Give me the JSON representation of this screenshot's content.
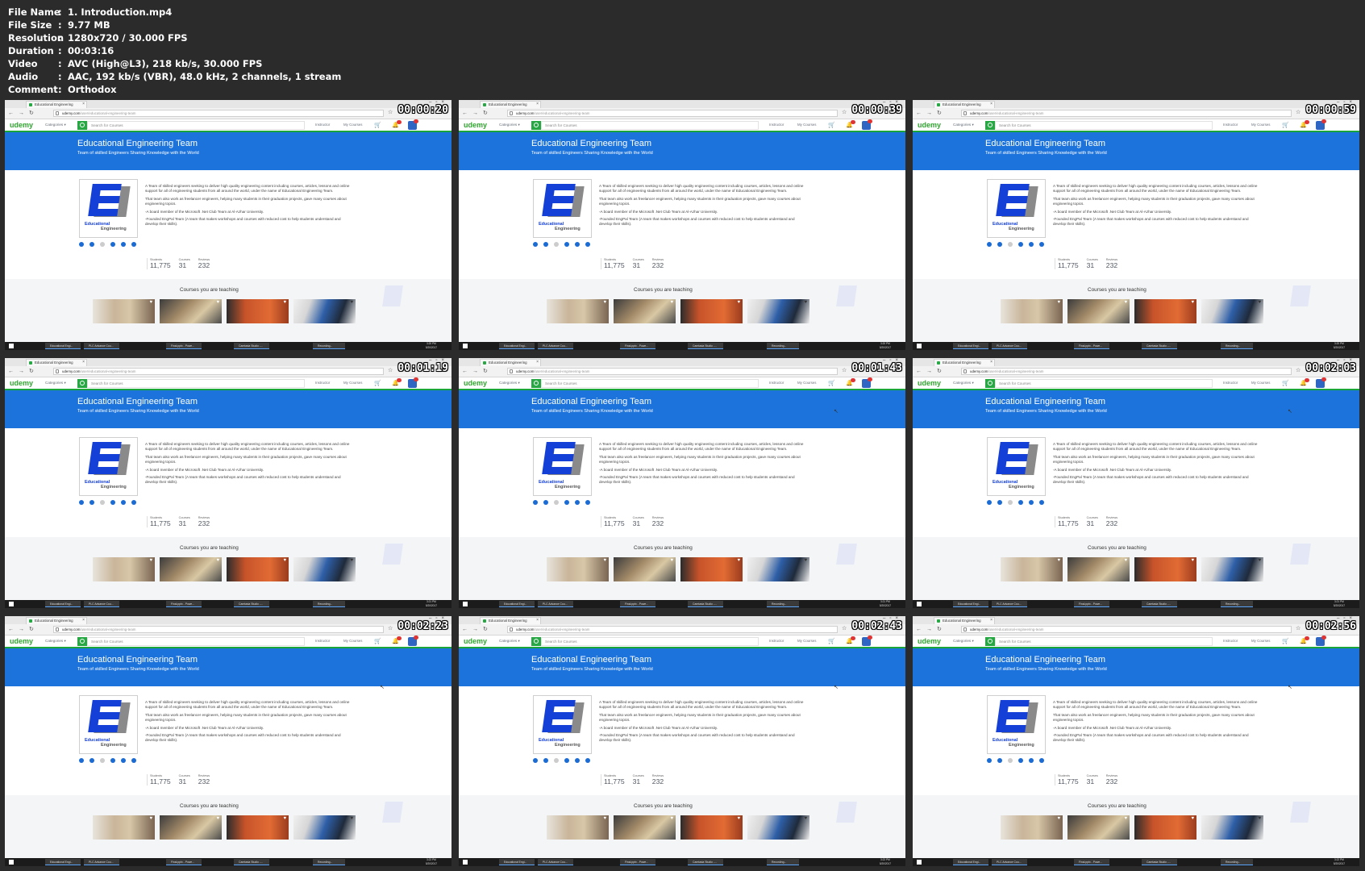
{
  "video_info": [
    {
      "key": "File Name",
      "value": "1. Introduction.mp4"
    },
    {
      "key": "File Size",
      "value": "9.77 MB"
    },
    {
      "key": "Resolution",
      "value": "1280x720 / 30.000 FPS"
    },
    {
      "key": "Duration",
      "value": "00:03:16"
    },
    {
      "key": "Video",
      "value": "AVC (High@L3), 218 kb/s, 30.000 FPS"
    },
    {
      "key": "Audio",
      "value": "AAC, 192 kb/s (VBR), 48.0 kHz, 2 channels, 1 stream"
    },
    {
      "key": "Comment",
      "value": "Orthodox"
    }
  ],
  "meta_separator": ":",
  "timestamps": [
    "00:00:20",
    "00:00:39",
    "00:00:59",
    "00:01:19",
    "00:01:43",
    "00:02:03",
    "00:02:23",
    "00:02:43",
    "00:02:56"
  ],
  "browser": {
    "tab_title": "Educational Engineering",
    "url_host": "udemy.com",
    "url_path": "/user/educational-engineering-team"
  },
  "nav": {
    "logo": "udemy",
    "categories": "Categories ▾",
    "search_placeholder": "Search for Courses",
    "instructor": "Instructor",
    "my_courses": "My Courses"
  },
  "profile": {
    "title": "Educational Engineering Team",
    "subtitle": "Team of skilled Engineers Sharing Knowledge with the World",
    "logo_line1": "Educational",
    "logo_line2": "Engineering",
    "bio": [
      "A Team of skilled engineers seeking to deliver high quality engineering content including courses, articles, lessons and online support for all of engineering students from all around the world, under the name of Educational Engineering Team.",
      "That team also work as freelancer engineers, helping many students in their graduation projects, gave many courses about engineering topics.",
      "-A board member of the Microsoft .Net Club Team at Al-Azhar University.",
      "-Founded EngPal Team (A team that makes workshops and courses with reduced cost to help students understand and develop their skills)."
    ],
    "stats": [
      {
        "label": "Students",
        "value": "11,775"
      },
      {
        "label": "Courses",
        "value": "31"
      },
      {
        "label": "Reviews",
        "value": "232"
      }
    ],
    "teaching_title": "Courses you are teaching"
  },
  "taskbar": {
    "items": [
      "Educational Engi...",
      "PLC Advance Cou...",
      "Final.pptx - Powe...",
      "Camtasia Studio -...",
      "Recording..."
    ],
    "lang": "ENG",
    "clock_times": [
      "3:20 PM",
      "3:20 PM",
      "3:20 PM",
      "3:21 PM",
      "3:21 PM",
      "3:21 PM",
      "3:22 PM",
      "3:22 PM",
      "3:22 PM"
    ],
    "date": "5/20/2017"
  },
  "colors": {
    "hero_blue": "#1c73dc",
    "udemy_green": "#2ea52e",
    "taskbar": "#1b1b1b",
    "background": "#2b2b2b"
  }
}
